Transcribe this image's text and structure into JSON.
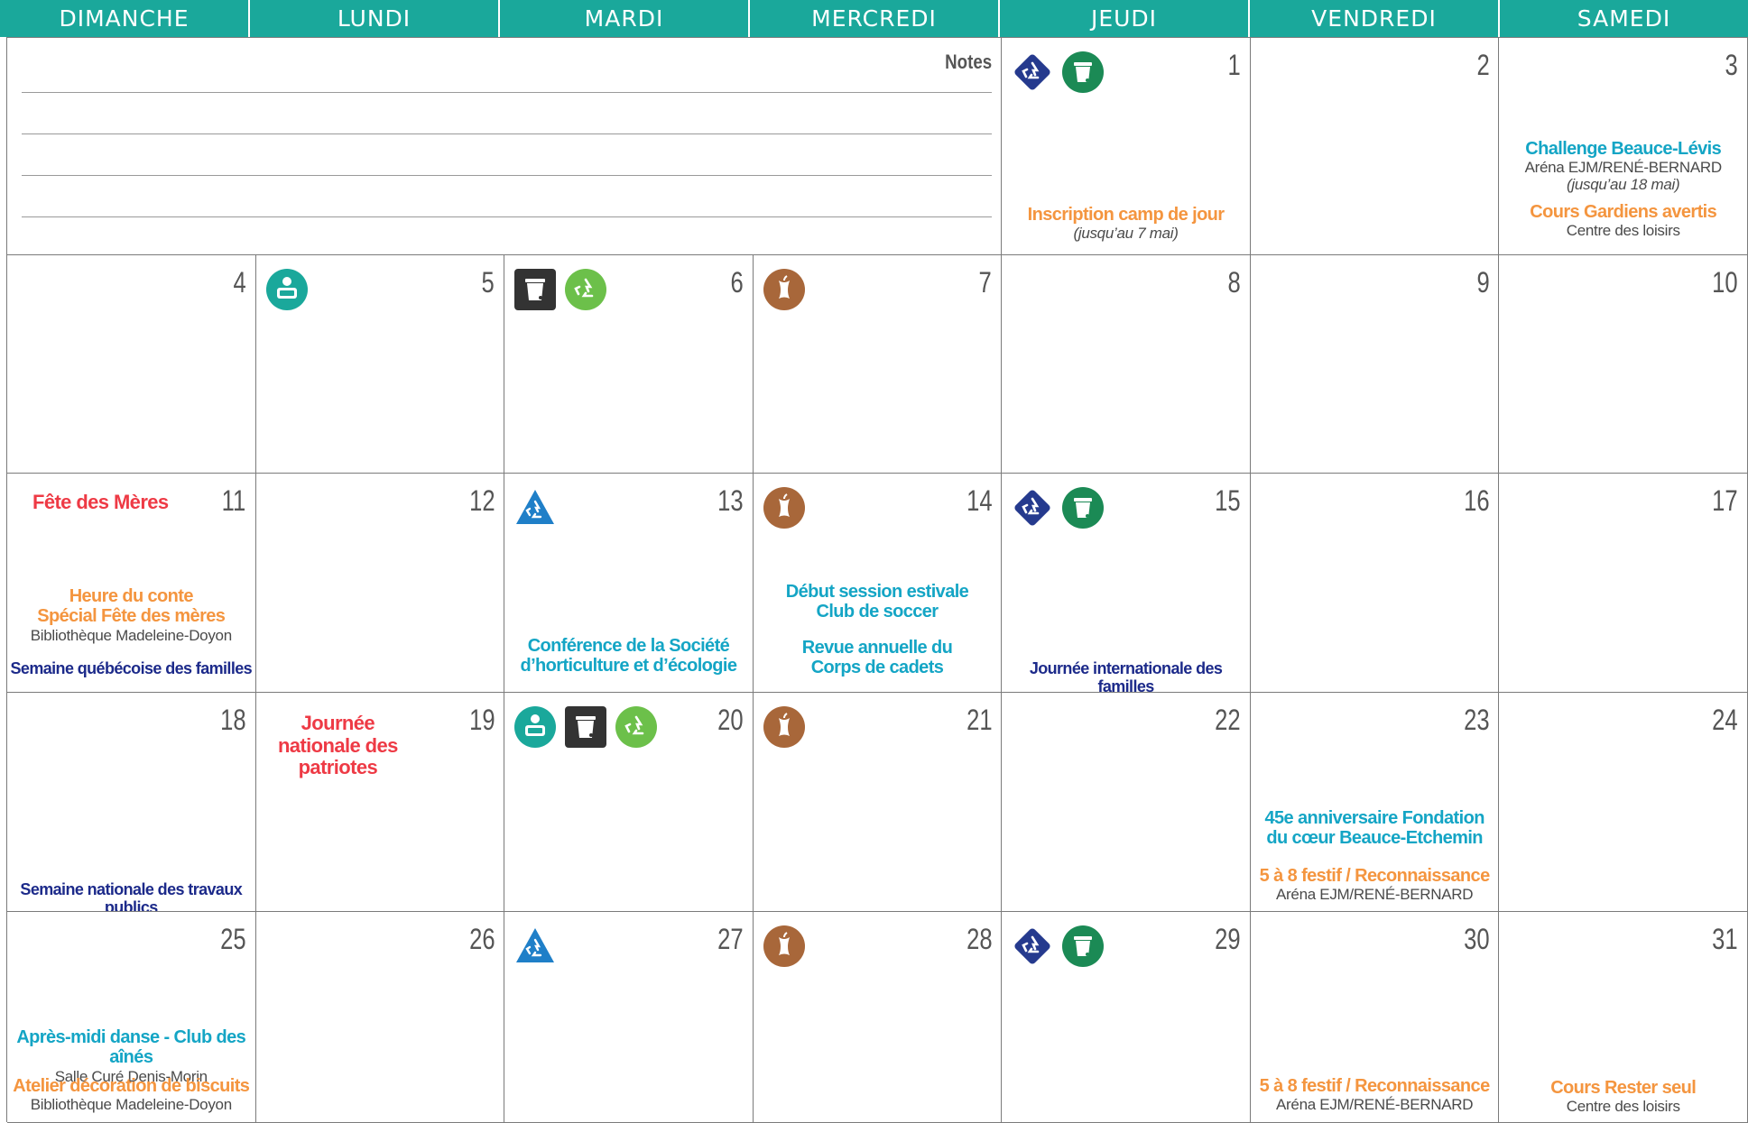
{
  "days_of_week": [
    "DIMANCHE",
    "LUNDI",
    "MARDI",
    "MERCREDI",
    "JEUDI",
    "VENDREDI",
    "SAMEDI"
  ],
  "notes_label": "Notes",
  "colors": {
    "header": "#1aa89b",
    "cyan": "#14a5c5",
    "orange": "#f4953f",
    "red": "#ee3a45",
    "navy": "#1c2a8a",
    "gray": "#4a4a4a"
  },
  "days": {
    "d1": {
      "num": "1",
      "icons": [
        "recycling-diamond-icon",
        "garbage-bin-green-icon"
      ],
      "events": [
        {
          "lines": [
            [
              "Inscription camp de jour",
              "orange"
            ],
            [
              "(jusqu’au 7 mai)",
              "grayi"
            ]
          ]
        }
      ]
    },
    "d2": {
      "num": "2"
    },
    "d3": {
      "num": "3",
      "events": [
        {
          "lines": [
            [
              "Challenge Beauce-Lévis",
              "cyan"
            ],
            [
              "Aréna EJM/RENÉ-BERNARD",
              "gray"
            ],
            [
              "(jusqu’au 18 mai)",
              "grayi"
            ]
          ]
        },
        {
          "lines": [
            [
              "Cours Gardiens avertis",
              "orange"
            ],
            [
              "Centre des loisirs",
              "gray"
            ]
          ]
        }
      ]
    },
    "d4": {
      "num": "4"
    },
    "d5": {
      "num": "5",
      "icons": [
        "bulky-items-icon"
      ]
    },
    "d6": {
      "num": "6",
      "icons": [
        "garbage-bin-dark-icon",
        "recycling-green-icon"
      ]
    },
    "d7": {
      "num": "7",
      "icons": [
        "compost-apple-icon"
      ]
    },
    "d8": {
      "num": "8"
    },
    "d9": {
      "num": "9"
    },
    "d10": {
      "num": "10"
    },
    "d11": {
      "num": "11",
      "title": "Fête des Mères",
      "events": [
        {
          "lines": [
            [
              "Heure du conte",
              "orange"
            ],
            [
              "Spécial Fête des mères",
              "orange"
            ],
            [
              "Bibliothèque Madeleine-Doyon",
              "gray"
            ]
          ]
        },
        {
          "lines": [
            [
              "Semaine québécoise des familles",
              "navy"
            ]
          ]
        }
      ]
    },
    "d12": {
      "num": "12"
    },
    "d13": {
      "num": "13",
      "icons": [
        "recycling-triangle-icon"
      ],
      "events": [
        {
          "lines": [
            [
              "Conférence de la Société",
              "cyan"
            ],
            [
              "d’horticulture et d’écologie",
              "cyan"
            ]
          ]
        }
      ]
    },
    "d14": {
      "num": "14",
      "icons": [
        "compost-apple-icon"
      ],
      "events": [
        {
          "lines": [
            [
              "Début session estivale",
              "cyan"
            ],
            [
              "Club de soccer",
              "cyan"
            ]
          ]
        },
        {
          "lines": [
            [
              "Revue annuelle du",
              "cyan"
            ],
            [
              "Corps de cadets",
              "cyan"
            ]
          ]
        }
      ]
    },
    "d15": {
      "num": "15",
      "icons": [
        "recycling-diamond-icon",
        "garbage-bin-green-icon"
      ],
      "events": [
        {
          "lines": [
            [
              "Journée internationale des familles",
              "navy"
            ]
          ]
        }
      ]
    },
    "d16": {
      "num": "16"
    },
    "d17": {
      "num": "17"
    },
    "d18": {
      "num": "18",
      "events": [
        {
          "lines": [
            [
              "Semaine nationale des travaux publics",
              "navy"
            ]
          ]
        }
      ]
    },
    "d19": {
      "num": "19",
      "title": "Journée nationale des patriotes"
    },
    "d20": {
      "num": "20",
      "icons": [
        "bulky-items-icon",
        "garbage-bin-dark-icon",
        "recycling-green-icon"
      ]
    },
    "d21": {
      "num": "21",
      "icons": [
        "compost-apple-icon"
      ]
    },
    "d22": {
      "num": "22"
    },
    "d23": {
      "num": "23",
      "events": [
        {
          "lines": [
            [
              "45e anniversaire Fondation",
              "cyan"
            ],
            [
              "du cœur Beauce-Etchemin",
              "cyan"
            ]
          ]
        },
        {
          "lines": [
            [
              "5 à 8 festif / Reconnaissance",
              "orange"
            ],
            [
              "Aréna EJM/RENÉ-BERNARD",
              "gray"
            ]
          ]
        }
      ]
    },
    "d24": {
      "num": "24"
    },
    "d25": {
      "num": "25",
      "events": [
        {
          "lines": [
            [
              "Après-midi danse - Club des aînés",
              "cyan"
            ],
            [
              "Salle Curé Denis-Morin",
              "gray"
            ]
          ]
        },
        {
          "lines": [
            [
              "Atelier décoration de biscuits",
              "orange"
            ],
            [
              "Bibliothèque Madeleine-Doyon",
              "gray"
            ]
          ]
        }
      ]
    },
    "d26": {
      "num": "26"
    },
    "d27": {
      "num": "27",
      "icons": [
        "recycling-triangle-icon"
      ]
    },
    "d28": {
      "num": "28",
      "icons": [
        "compost-apple-icon"
      ]
    },
    "d29": {
      "num": "29",
      "icons": [
        "recycling-diamond-icon",
        "garbage-bin-green-icon"
      ]
    },
    "d30": {
      "num": "30",
      "events": [
        {
          "lines": [
            [
              "5 à 8 festif / Reconnaissance",
              "orange"
            ],
            [
              "Aréna EJM/RENÉ-BERNARD",
              "gray"
            ]
          ]
        }
      ]
    },
    "d31": {
      "num": "31",
      "events": [
        {
          "lines": [
            [
              "Cours Rester seul",
              "orange"
            ],
            [
              "Centre des loisirs",
              "gray"
            ]
          ]
        }
      ]
    }
  }
}
